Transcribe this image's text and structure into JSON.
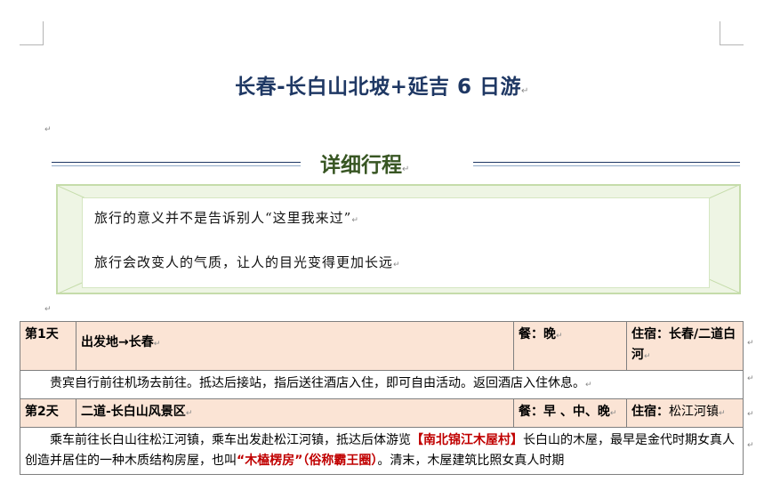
{
  "document": {
    "title": "长春-长白山北坡+延吉 6 日游",
    "section_title": "详细行程",
    "quote_lines": [
      "旅行的意义并不是告诉别人“这里我来过”",
      "旅行会改变人的气质，让人的目光变得更加长远"
    ],
    "paragraph_mark": "↵"
  },
  "itinerary": {
    "day1": {
      "day_label": "第1天",
      "route": "出发地→长春",
      "meals": "餐：晚",
      "stay_label": "住宿：",
      "stay_value": "长春/二道白河",
      "description": "贵宾自行前往机场去前往。抵达后接站，指后送往酒店入住，即可自由活动。返回酒店入住休息。"
    },
    "day2": {
      "day_label": "第2天",
      "route": "二道-长白山风景区",
      "meals": "餐：早 、中、晚",
      "stay_label": "住宿：",
      "stay_value": "松江河镇",
      "desc_part1": "乘车前往长白山往松江河镇，乘车出发赴松江河镇，抵达后体游览",
      "desc_highlight1": "【南北锦江木屋村】",
      "desc_part2": "长白山的木屋，最早是金代时期女真人创造并居住的一种木质结构房屋，也叫",
      "desc_highlight2": "“木榼楞房”（俗称霸王圈）",
      "desc_part3": "。清末，木屋建筑比照女真人时期"
    }
  }
}
